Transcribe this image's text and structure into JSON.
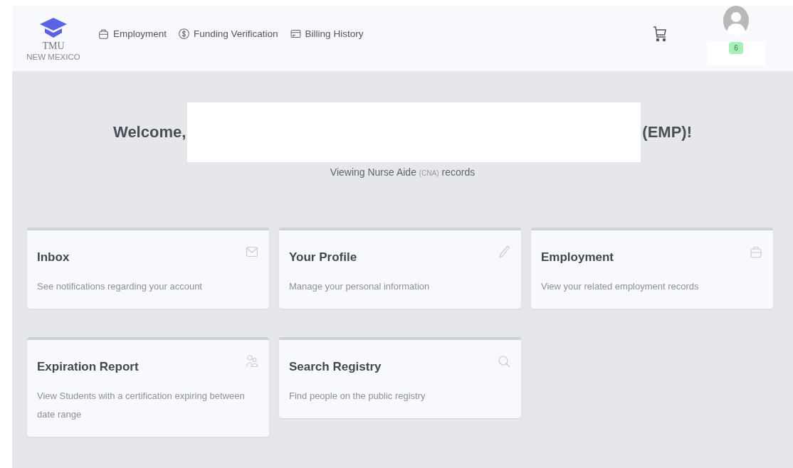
{
  "header": {
    "logo": {
      "title": "TMU",
      "subtitle": "NEW MEXICO"
    },
    "nav": [
      {
        "label": "Employment"
      },
      {
        "label": "Funding Verification"
      },
      {
        "label": "Billing History"
      }
    ],
    "user": {
      "badge": "6"
    }
  },
  "welcome": {
    "greeting": "Welcome,",
    "suffix": "(EMP)!",
    "subtitle": {
      "before": "Viewing Nurse Aide",
      "abbreviation": "(CNA)",
      "after": "records"
    }
  },
  "cards": [
    {
      "title": "Inbox",
      "description": "See notifications regarding your account"
    },
    {
      "title": "Your Profile",
      "description": "Manage your personal information"
    },
    {
      "title": "Employment",
      "description": "View your related employment records"
    },
    {
      "title": "Expiration Report",
      "description": "View Students with a certification expiring between date range"
    },
    {
      "title": "Search Registry",
      "description": "Find people on the public registry"
    }
  ]
}
